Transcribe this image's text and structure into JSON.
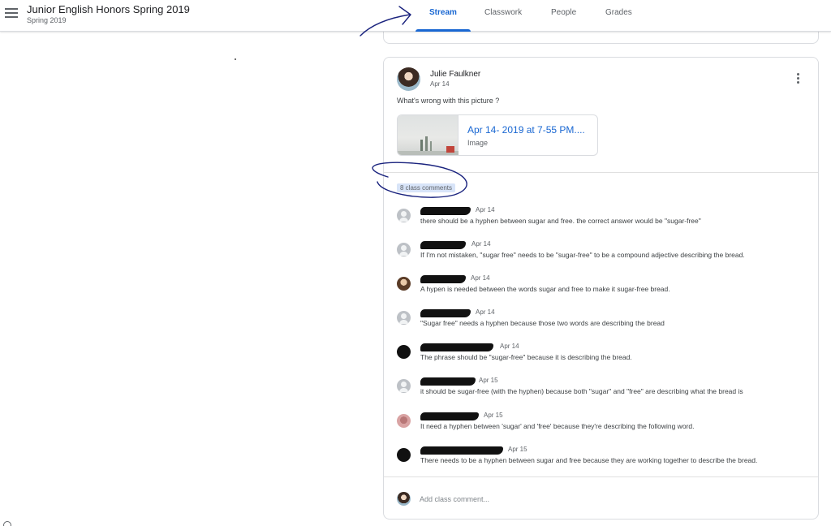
{
  "header": {
    "class_title": "Junior English Honors Spring 2019",
    "class_subtitle": "Spring 2019",
    "tabs": [
      {
        "label": "Stream",
        "active": true
      },
      {
        "label": "Classwork",
        "active": false
      },
      {
        "label": "People",
        "active": false
      },
      {
        "label": "Grades",
        "active": false
      }
    ]
  },
  "post": {
    "author": "Julie Faulkner",
    "date": "Apr 14",
    "text": "What's wrong with this picture ?",
    "attachment": {
      "title": "Apr 14- 2019 at 7-55 PM....",
      "type": "Image"
    },
    "comments_link": "8 class comments",
    "comments": [
      {
        "date": "Apr 14",
        "text": "there should be a hyphen between sugar and free. the correct answer would be \"sugar-free\""
      },
      {
        "date": "Apr 14",
        "text": "If I'm not mistaken, \"sugar free\" needs to be \"sugar-free\" to be a compound adjective describing the bread."
      },
      {
        "date": "Apr 14",
        "text": "A hypen is needed between the words sugar and free to make it sugar-free bread."
      },
      {
        "date": "Apr 14",
        "text": "\"Sugar free\" needs a hyphen because those two words are describing the bread"
      },
      {
        "date": "Apr 14",
        "text": "The phrase should be \"sugar-free\" because it is describing the bread."
      },
      {
        "date": "Apr 15",
        "text": "it should be sugar-free (with the hyphen) because both \"sugar\" and \"free\" are describing what the bread is"
      },
      {
        "date": "Apr 15",
        "text": "It need a hyphen between 'sugar' and 'free' because they're describing the following word."
      },
      {
        "date": "Apr 15",
        "text": "There needs to be a hyphen between sugar and free because they are working together to describe the bread."
      }
    ],
    "add_comment_placeholder": "Add class comment..."
  },
  "colors": {
    "accent": "#1967d2",
    "ink": "#1a237e"
  },
  "icons": {
    "menu": "hamburger-menu-icon",
    "more": "more-vertical-icon"
  }
}
